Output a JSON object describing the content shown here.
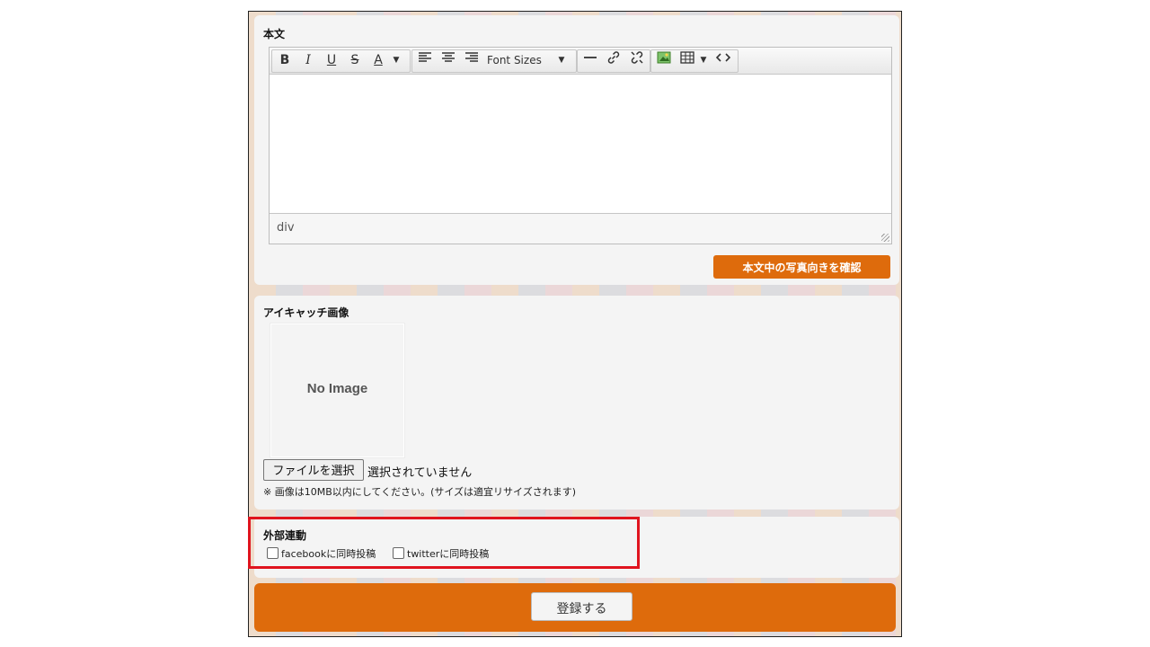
{
  "body_section": {
    "label": "本文",
    "toolbar": {
      "bold": "B",
      "italic": "I",
      "underline": "U",
      "strike": "S",
      "font_color": "A",
      "font_sizes": "Font Sizes"
    },
    "status_path": "div",
    "check_photo_button": "本文中の写真向きを確認"
  },
  "eyecatch": {
    "label": "アイキャッチ画像",
    "placeholder_image": "No Image",
    "file_button": "ファイルを選択",
    "file_status": "選択されていません",
    "note": "※ 画像は10MB以内にしてください。(サイズは適宜リサイズされます)"
  },
  "external": {
    "label": "外部連動",
    "facebook_label": "facebookに同時投稿",
    "twitter_label": "twitterに同時投稿",
    "facebook_checked": false,
    "twitter_checked": false
  },
  "submit_label": "登録する",
  "colors": {
    "accent": "#de6b0c",
    "highlight": "#e0141e"
  }
}
